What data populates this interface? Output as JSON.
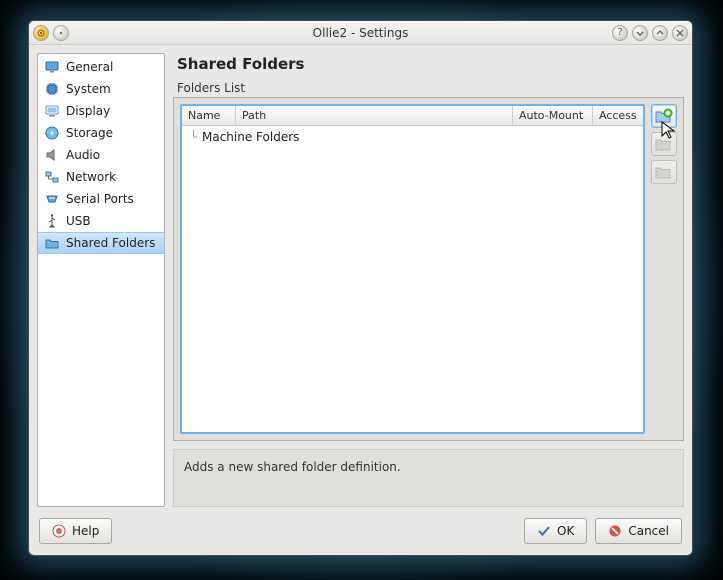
{
  "window": {
    "title": "Ollie2 - Settings"
  },
  "sidebar": {
    "items": [
      {
        "label": "General",
        "icon": "monitor-blue"
      },
      {
        "label": "System",
        "icon": "chip"
      },
      {
        "label": "Display",
        "icon": "display"
      },
      {
        "label": "Storage",
        "icon": "disc"
      },
      {
        "label": "Audio",
        "icon": "speaker"
      },
      {
        "label": "Network",
        "icon": "network"
      },
      {
        "label": "Serial Ports",
        "icon": "serial"
      },
      {
        "label": "USB",
        "icon": "usb"
      },
      {
        "label": "Shared Folders",
        "icon": "folder",
        "selected": true
      }
    ]
  },
  "page": {
    "heading": "Shared Folders",
    "group_label": "Folders List",
    "columns": {
      "name": "Name",
      "path": "Path",
      "mount": "Auto-Mount",
      "access": "Access"
    },
    "root_row": "Machine Folders",
    "hint": "Adds a new shared folder definition."
  },
  "toolbar": {
    "add": {
      "name": "add-shared-folder-button"
    },
    "edit": {
      "name": "edit-shared-folder-button"
    },
    "remove": {
      "name": "remove-shared-folder-button"
    }
  },
  "buttons": {
    "help": "Help",
    "ok": "OK",
    "cancel": "Cancel"
  }
}
